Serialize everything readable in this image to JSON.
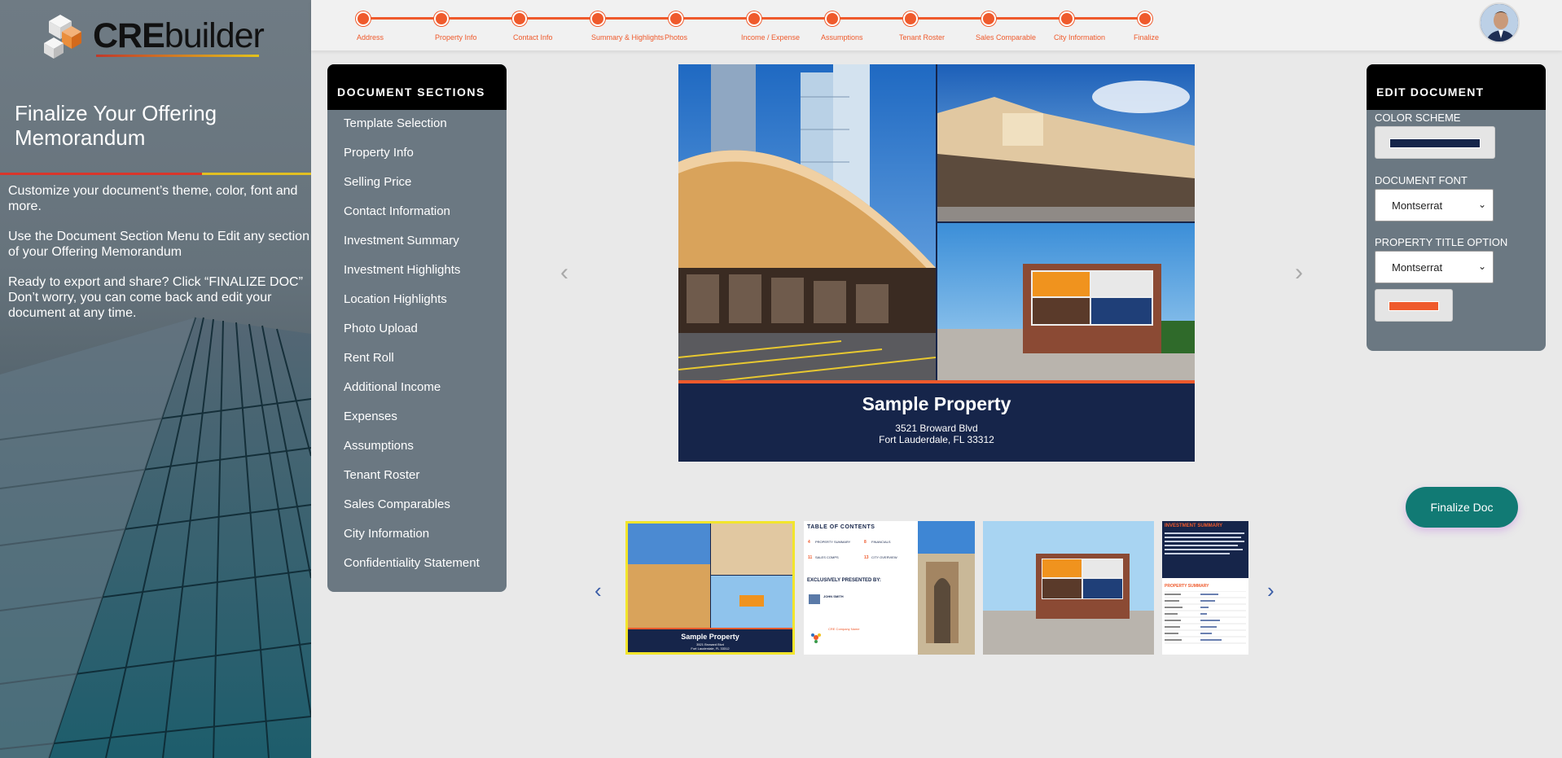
{
  "sidebar": {
    "logo_cre": "CRE",
    "logo_builder": "builder",
    "title": "Finalize Your Offering Memorandum",
    "para1": "Customize your document’s theme, color, font and more.",
    "para2": "Use the Document Section Menu to Edit any section of your Offering Memorandum",
    "para3": "Ready to export and share? Click “FINALIZE DOC” Don’t worry, you can come back and edit your document at any time."
  },
  "stepper": {
    "steps": [
      "Address",
      "Property Info",
      "Contact Info",
      "Summary & Highlights",
      "Photos",
      "Income / Expense",
      "Assumptions",
      "Tenant Roster",
      "Sales Comparable",
      "City Information",
      "Finalize"
    ],
    "accent": "#ef5a2c"
  },
  "sections": {
    "heading": "DOCUMENT SECTIONS",
    "items": [
      "Template Selection",
      "Property Info",
      "Selling Price",
      "Contact Information",
      "Investment Summary",
      "Investment Highlights",
      "Location Highlights",
      "Photo Upload",
      "Rent Roll",
      "Additional Income",
      "Expenses",
      "Assumptions",
      "Tenant Roster",
      "Sales Comparables",
      "City Information",
      "Confidentiality Statement"
    ]
  },
  "preview": {
    "title": "Sample Property",
    "address1": "3521 Broward Blvd",
    "address2": "Fort Lauderdale, FL 33312",
    "navy": "#16254a"
  },
  "thumbs": {
    "t1_title": "Sample Property",
    "t1_addr1": "3521 Broward Blvd",
    "t1_addr2": "Fort Lauderdale, FL 33312",
    "t2_heading": "TABLE OF CONTENTS",
    "t2_toc": [
      {
        "num": "4",
        "label": "PROPERTY SUMMARY"
      },
      {
        "num": "8",
        "label": "FINANCIALS"
      },
      {
        "num": "11",
        "label": "SALES COMPS"
      },
      {
        "num": "13",
        "label": "CITY OVERVIEW"
      }
    ],
    "t2_presented": "EXCLUSIVELY PRESENTED BY:",
    "t2_name": "JOHN SMITH",
    "t2_company": "CRE Company Name",
    "t4_heading": "INVESTMENT SUMMARY",
    "t4_subheading": "PROPERTY SUMMARY"
  },
  "edit": {
    "heading": "EDIT DOCUMENT",
    "color_label": "COLOR SCHEME",
    "font_label": "DOCUMENT FONT",
    "font_value": "Montserrat",
    "title_label": "PROPERTY TITLE OPTION",
    "title_value": "Montserrat",
    "scheme_color": "#16254a",
    "accent_color": "#ef5a2c"
  },
  "finalize_label": "Finalize Doc"
}
